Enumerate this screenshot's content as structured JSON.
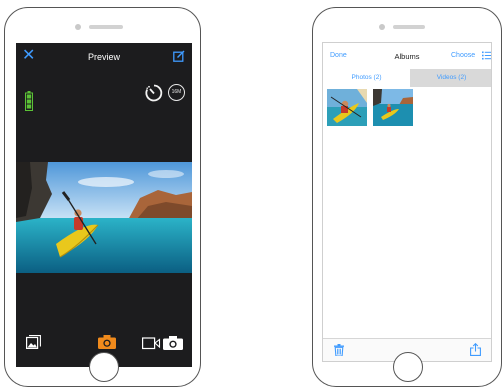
{
  "left_phone": {
    "header": {
      "close_icon": "close-icon",
      "title": "Preview",
      "edit_icon": "edit-icon"
    },
    "status": {
      "battery_icon": "battery-icon",
      "timer_icon": "self-timer-icon",
      "resolution_badge": "16M"
    },
    "preview_image": "kayak-on-sea-photo",
    "toolbar": {
      "gallery_icon": "gallery-icon",
      "photo_mode_icon": "camera-icon",
      "switch_mode_icon": "video-photo-switch-icon"
    }
  },
  "right_phone": {
    "header": {
      "done_label": "Done",
      "title": "Albums",
      "choose_label": "Choose",
      "list_icon": "list-icon"
    },
    "tabs": [
      {
        "label": "Photos (2)",
        "selected": true
      },
      {
        "label": "Videos (2)",
        "selected": false
      }
    ],
    "thumbnails": [
      "kayak-thumbnail",
      "kayak-thumbnail"
    ],
    "footer": {
      "trash_icon": "trash-icon",
      "share_icon": "share-icon"
    }
  },
  "colors": {
    "accent_blue": "#3f9bff",
    "camera_orange": "#f08a1c",
    "battery_green": "#5bc236",
    "screen_dark": "#1c1c1e"
  }
}
